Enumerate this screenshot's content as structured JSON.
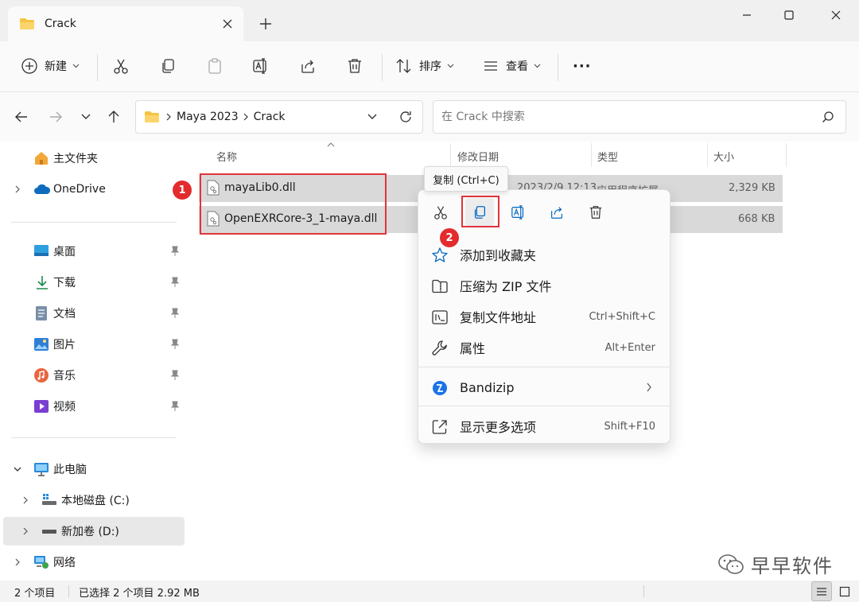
{
  "window": {
    "tab_title": "Crack"
  },
  "toolbar": {
    "new_label": "新建",
    "sort_label": "排序",
    "view_label": "查看",
    "more_label": "···"
  },
  "address": {
    "crumbs": [
      "Maya 2023",
      "Crack"
    ],
    "search_placeholder": "在 Crack 中搜索"
  },
  "sidebar": {
    "home": "主文件夹",
    "onedrive": "OneDrive",
    "quick": [
      {
        "label": "桌面",
        "icon": "desktop-icon"
      },
      {
        "label": "下载",
        "icon": "download-icon"
      },
      {
        "label": "文档",
        "icon": "documents-icon"
      },
      {
        "label": "图片",
        "icon": "pictures-icon"
      },
      {
        "label": "音乐",
        "icon": "music-icon"
      },
      {
        "label": "视频",
        "icon": "video-icon"
      }
    ],
    "this_pc": "此电脑",
    "drive_c": "本地磁盘 (C:)",
    "drive_d": "新加卷 (D:)",
    "network": "网络"
  },
  "columns": {
    "name": "名称",
    "date": "修改日期",
    "type": "类型",
    "size": "大小"
  },
  "files": [
    {
      "name": "mayaLib0.dll",
      "date": "2023/2/9 12:13",
      "type": "应用程序扩展",
      "size": "2,329 KB"
    },
    {
      "name": "OpenEXRCore-3_1-maya.dll",
      "date": "",
      "type": "",
      "size": "668 KB"
    }
  ],
  "annotations": {
    "badge1": "1",
    "badge2": "2"
  },
  "tooltip": "复制 (Ctrl+C)",
  "context_menu": {
    "items": [
      {
        "label": "添加到收藏夹",
        "shortcut": ""
      },
      {
        "label": "压缩为 ZIP 文件",
        "shortcut": ""
      },
      {
        "label": "复制文件地址",
        "shortcut": "Ctrl+Shift+C"
      },
      {
        "label": "属性",
        "shortcut": "Alt+Enter"
      },
      {
        "label": "Bandizip",
        "shortcut": ""
      },
      {
        "label": "显示更多选项",
        "shortcut": "Shift+F10"
      }
    ]
  },
  "status": {
    "count": "2 个项目",
    "selected": "已选择 2 个项目 2.92 MB"
  },
  "watermark": "早早软件",
  "colors": {
    "accent": "#0067c0",
    "highlight_red": "#e2343a",
    "selection_gray": "#d9d9d9",
    "folder_yellow": "#f6c344"
  }
}
